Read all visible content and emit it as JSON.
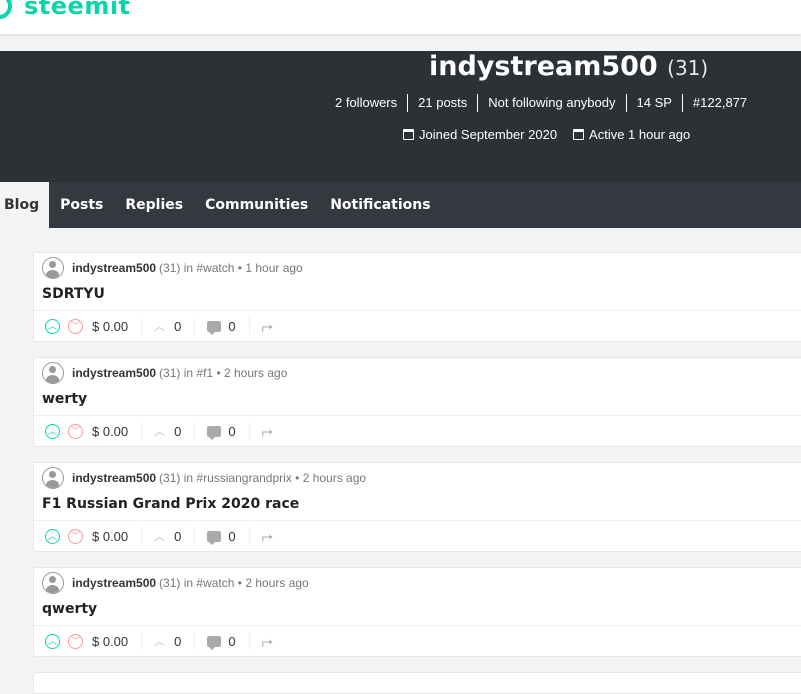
{
  "logo": {
    "text": "steemit"
  },
  "profile": {
    "username": "indystream500",
    "reputation": "(31)",
    "stats": [
      "2 followers",
      "21 posts",
      "Not following anybody",
      "14 SP",
      "#122,877"
    ],
    "joined": "Joined September 2020",
    "active": "Active 1 hour ago"
  },
  "tabs": [
    "Blog",
    "Posts",
    "Replies",
    "Communities",
    "Notifications"
  ],
  "posts": [
    {
      "author": "indystream500",
      "rep": "(31)",
      "in": "in",
      "community": "#watch",
      "time": "• 1 hour ago",
      "title": "SDRTYU",
      "payout": "$ 0.00",
      "votes": "0",
      "comments": "0"
    },
    {
      "author": "indystream500",
      "rep": "(31)",
      "in": "in",
      "community": "#f1",
      "time": "• 2 hours ago",
      "title": "werty",
      "payout": "$ 0.00",
      "votes": "0",
      "comments": "0"
    },
    {
      "author": "indystream500",
      "rep": "(31)",
      "in": "in",
      "community": "#russiangrandprix",
      "time": "• 2 hours ago",
      "title": "F1 Russian Grand Prix 2020 race",
      "payout": "$ 0.00",
      "votes": "0",
      "comments": "0"
    },
    {
      "author": "indystream500",
      "rep": "(31)",
      "in": "in",
      "community": "#watch",
      "time": "• 2 hours ago",
      "title": "qwerty",
      "payout": "$ 0.00",
      "votes": "0",
      "comments": "0"
    }
  ],
  "colors": {
    "brand": "#06d6a9",
    "banner": "#2c3136",
    "nav": "#34393f"
  }
}
